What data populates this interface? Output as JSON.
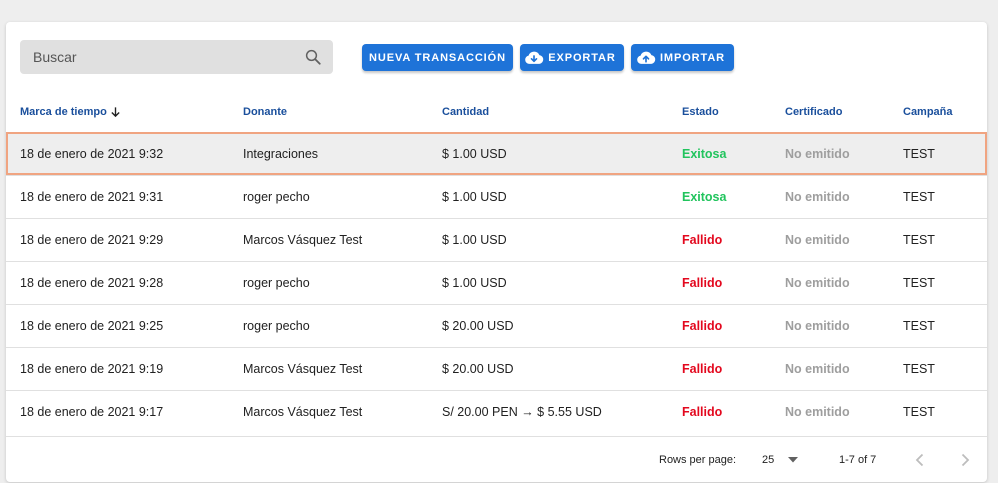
{
  "search": {
    "placeholder": "Buscar"
  },
  "toolbar": {
    "new_label": "NUEVA TRANSACCIÓN",
    "export_label": "EXPORTAR",
    "import_label": "IMPORTAR"
  },
  "table": {
    "headers": [
      "Marca de tiempo",
      "Donante",
      "Cantidad",
      "Estado",
      "Certificado",
      "Campaña"
    ],
    "rows": [
      [
        "18 de enero de 2021 9:32",
        "Integraciones",
        "$ 1.00 USD",
        "Exitosa",
        "No emitido",
        "TEST"
      ],
      [
        "18 de enero de 2021 9:31",
        "roger pecho",
        "$ 1.00 USD",
        "Exitosa",
        "No emitido",
        "TEST"
      ],
      [
        "18 de enero de 2021 9:29",
        "Marcos Vásquez Test",
        "$ 1.00 USD",
        "Fallido",
        "No emitido",
        "TEST"
      ],
      [
        "18 de enero de 2021 9:28",
        "roger pecho",
        "$ 1.00 USD",
        "Fallido",
        "No emitido",
        "TEST"
      ],
      [
        "18 de enero de 2021 9:25",
        "roger pecho",
        "$ 20.00 USD",
        "Fallido",
        "No emitido",
        "TEST"
      ],
      [
        "18 de enero de 2021 9:19",
        "Marcos Vásquez Test",
        "$ 20.00 USD",
        "Fallido",
        "No emitido",
        "TEST"
      ],
      [
        "18 de enero de 2021 9:17",
        "Marcos Vásquez Test",
        "S/ 20.00 PEN → $ 5.55 USD",
        "Fallido",
        "No emitido",
        "TEST"
      ]
    ]
  },
  "footer": {
    "rows_per_page_label": "Rows per page:",
    "rows_per_page": "25",
    "range": "1-7 of 7"
  },
  "colors": {
    "primary": "#1e73d8",
    "success": "#21c45d",
    "error": "#e3081e",
    "header_text": "#1a4f9c",
    "highlight_border": "#f0a481"
  },
  "icons": [
    "search-icon",
    "cloud-download-icon",
    "cloud-upload-icon",
    "arrow-down-icon",
    "caret-down-icon",
    "chevron-left-icon",
    "chevron-right-icon"
  ]
}
